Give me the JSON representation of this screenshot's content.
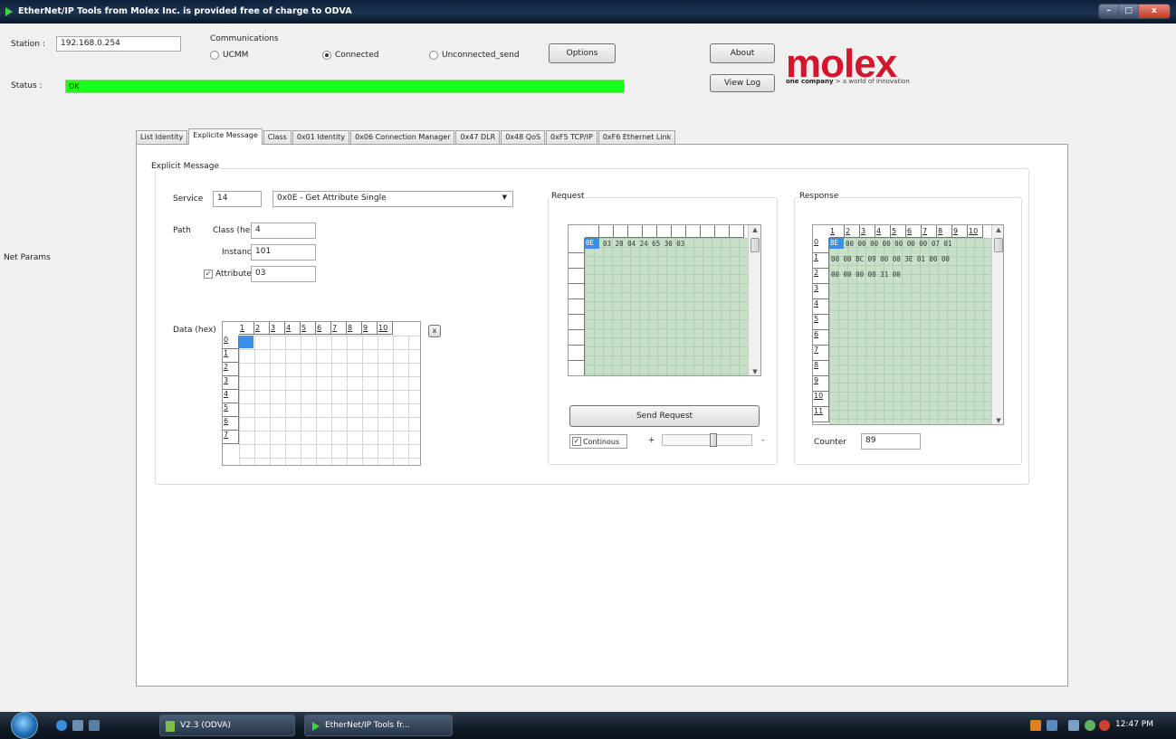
{
  "window": {
    "title": "EtherNet/IP Tools from Molex Inc. is provided free of charge to ODVA",
    "ctl_min": "–",
    "ctl_max": "□",
    "ctl_close": "x"
  },
  "header": {
    "station_label": "Station :",
    "station_value": "192.168.0.254",
    "status_label": "Status :",
    "status_value": "OK",
    "status_color": "#1aff1a",
    "comm_label": "Communications",
    "radio_ucmm": "UCMM",
    "radio_connected": "Connected",
    "radio_unconnected": "Unconnected_send",
    "selected_mode": "Connected",
    "options_button": "Options",
    "about_button": "About",
    "viewlog_button": "View Log",
    "logo_text": "molex",
    "logo_color": "#d2162c",
    "tagline_bold": "one company",
    "tagline_rest": " > a world of innovation"
  },
  "left": {
    "net_params": "Net Params"
  },
  "tabs": [
    "List Identity",
    "Explicite Message",
    "Class",
    "0x01 Identity",
    "0x06 Connection Manager",
    "0x47 DLR",
    "0x48 QoS",
    "0xF5 TCP/IP",
    "0xF6 Ethernet Link"
  ],
  "active_tab": "Explicite Message",
  "explicit": {
    "group_title": "Explicit Message",
    "service_label": "Service",
    "service_value": "14",
    "service_dropdown": "0x0E - Get Attribute Single",
    "path_label": "Path",
    "class_label": "Class (hex)",
    "class_value": "4",
    "instance_label": "Instance",
    "instance_value": "101",
    "attribute_label": "Attribute",
    "attribute_checked": true,
    "attribute_value": "03",
    "data_label": "Data (hex)",
    "data_cols": [
      "1",
      "2",
      "3",
      "4",
      "5",
      "6",
      "7",
      "8",
      "9",
      "10"
    ],
    "data_rows": [
      "0",
      "1",
      "2",
      "3",
      "4",
      "5",
      "6",
      "7"
    ],
    "clear_button": "x"
  },
  "request": {
    "group_title": "Request",
    "hex_line": "03 20 04 24 65 30 03",
    "first_cell": "0E",
    "send_button": "Send Request",
    "continuous_label": "Continous",
    "continuous_checked": true,
    "slider_minus": "-",
    "slider_plus": "+"
  },
  "response": {
    "group_title": "Response",
    "cols": [
      "1",
      "2",
      "3",
      "4",
      "5",
      "6",
      "7",
      "8",
      "9",
      "10"
    ],
    "rows": [
      "0",
      "1",
      "2",
      "3",
      "4",
      "5",
      "6",
      "7",
      "8",
      "9",
      "10",
      "11"
    ],
    "first_cell": "8E",
    "lines": [
      "00 00 00 00 00 00 00 07 01",
      "00 00 BC 09 00 00 3E 01 00 00",
      "00 00 00 00 31 00"
    ],
    "counter_label": "Counter",
    "counter_value": "89"
  },
  "taskbar": {
    "btn1": "V2.3 (ODVA)",
    "btn2": "EtherNet/IP Tools fr...",
    "clock": "12:47 PM"
  }
}
